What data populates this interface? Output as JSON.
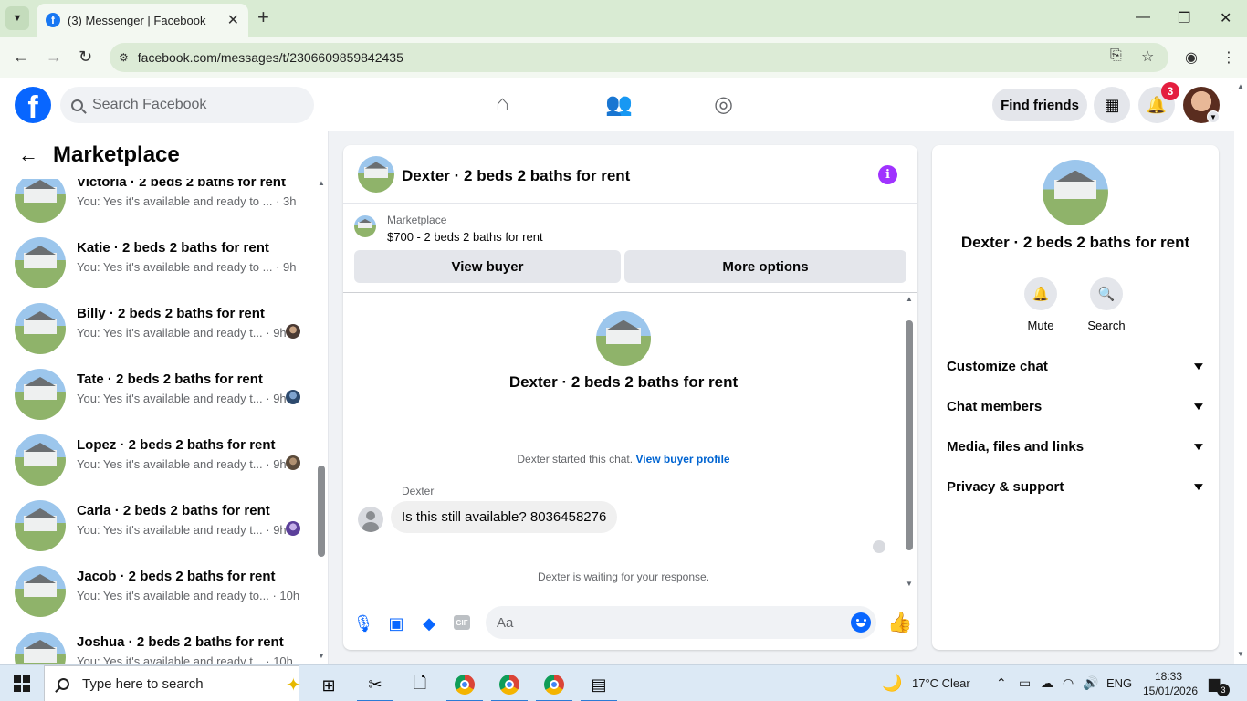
{
  "browser": {
    "tab_title": "(3) Messenger | Facebook",
    "tab_favicon": "f",
    "url": "facebook.com/messages/t/2306609859842435"
  },
  "fb_header": {
    "logo": "f",
    "search_placeholder": "Search Facebook",
    "find_friends": "Find friends",
    "notification_count": "3"
  },
  "sidebar": {
    "title": "Marketplace",
    "conversations": [
      {
        "name": "Victoria · 2 beds 2 baths for rent",
        "preview": "You: Yes it's available and ready to ... · 3h"
      },
      {
        "name": "Katie · 2 beds 2 baths for rent",
        "preview": "You: Yes it's available and ready to ... · 9h"
      },
      {
        "name": "Billy · 2 beds 2 baths for rent",
        "preview": "You: Yes it's available and ready t... · 9h"
      },
      {
        "name": "Tate · 2 beds 2 baths for rent",
        "preview": "You: Yes it's available and ready t... · 9h"
      },
      {
        "name": "Lopez · 2 beds 2 baths for rent",
        "preview": "You: Yes it's available and ready t... · 9h"
      },
      {
        "name": "Carla · 2 beds 2 baths for rent",
        "preview": "You: Yes it's available and ready t... · 9h"
      },
      {
        "name": "Jacob · 2 beds 2 baths for rent",
        "preview": "You: Yes it's available and ready to... · 10h"
      },
      {
        "name": "Joshua · 2 beds 2 baths for rent",
        "preview": "You: Yes it's available and ready t... · 10h"
      }
    ]
  },
  "chat": {
    "title": "Dexter · 2 beds 2 baths for rent",
    "marketplace_label": "Marketplace",
    "listing": "$700 - 2 beds 2 baths for rent",
    "view_buyer": "View buyer",
    "more_options": "More options",
    "body_title": "Dexter · 2 beds 2 baths for rent",
    "started_text": "Dexter started this chat.",
    "view_buyer_profile": "View buyer profile",
    "sender_name": "Dexter",
    "message": "Is this still available? 8036458276",
    "waiting": "Dexter is waiting for your response.",
    "composer_placeholder": "Aa",
    "gif_label": "GIF"
  },
  "details": {
    "title": "Dexter · 2 beds 2 baths for rent",
    "mute": "Mute",
    "search": "Search",
    "sections": [
      "Customize chat",
      "Chat members",
      "Media, files and links",
      "Privacy & support"
    ]
  },
  "taskbar": {
    "search_placeholder": "Type here to search",
    "weather": "17°C  Clear",
    "language": "ENG",
    "time": "18:33",
    "date": "15/01/2026",
    "notif_count": "3"
  },
  "colors": {
    "fb_blue": "#0866ff",
    "info_purple": "#a033ff",
    "badge_red": "#e41e3f"
  }
}
